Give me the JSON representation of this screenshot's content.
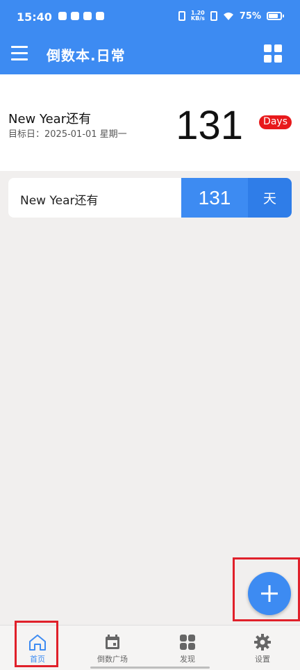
{
  "status_bar": {
    "time": "15:40",
    "speed_top": "1.20",
    "speed_bottom": "KB/s",
    "battery": "75%"
  },
  "appbar": {
    "title": "倒数本.日常",
    "menu_icon": "hamburger-menu-icon",
    "grid_icon": "grid-view-icon"
  },
  "featured": {
    "title": "New Year还有",
    "date": "目标日：2025-01-01 星期一",
    "count": "131",
    "unit": "Days"
  },
  "events": [
    {
      "title": "New Year还有",
      "count": "131",
      "unit": "天"
    }
  ],
  "fab": {
    "icon": "plus-icon"
  },
  "bottom_nav": [
    {
      "label": "首页",
      "icon": "home-icon",
      "active": true
    },
    {
      "label": "倒数广场",
      "icon": "calendar-icon",
      "active": false
    },
    {
      "label": "发现",
      "icon": "apps-grid-icon",
      "active": false
    },
    {
      "label": "设置",
      "icon": "gear-icon",
      "active": false
    }
  ],
  "colors": {
    "primary": "#3d8bf2",
    "unit_badge": "#e8191b",
    "highlight_box": "#e0202a"
  }
}
